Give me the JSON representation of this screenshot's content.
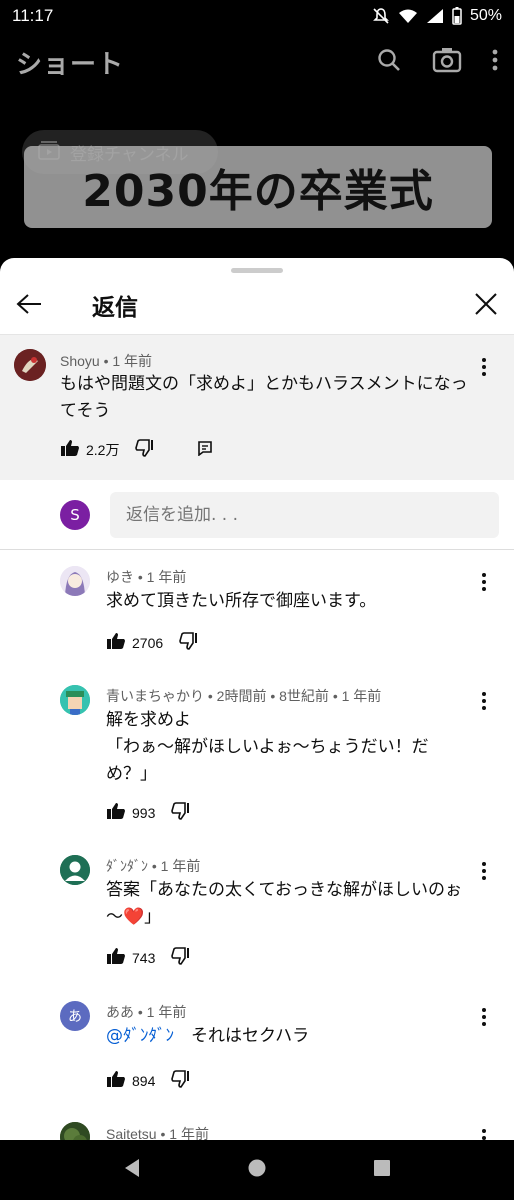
{
  "status": {
    "time": "11:17",
    "battery": "50%"
  },
  "header": {
    "title": "ショート"
  },
  "video": {
    "subscribed_label": "登録チャンネル",
    "caption": "2030年の卒業式"
  },
  "sheet": {
    "title": "返信"
  },
  "parent": {
    "author": "Shoyu • 1 年前",
    "text": "もはや問題文の「求めよ」とかもハラスメントになってそう",
    "likes": "2.2万"
  },
  "composer": {
    "avatar_letter": "S",
    "placeholder": "返信を追加. . ."
  },
  "replies": [
    {
      "author": "ゆき • 1 年前",
      "text": "求めて頂きたい所存で御座います。",
      "likes": "2706"
    },
    {
      "author": "青いまちゃかり • 2時間前 • 8世紀前 • 1 年前",
      "text1": "解を求めよ",
      "text2": "「わぁ～解がほしいよぉ～ちょうだい！だめ？」",
      "likes": "993"
    },
    {
      "author": "ﾀﾞﾝﾀﾞﾝ • 1 年前",
      "text": "答案「あなたの太くておっきな解がほしいのぉ～❤️」",
      "likes": "743"
    },
    {
      "author": "ああ • 1 年前",
      "avatar_letter": "あ",
      "mention": "@ﾀﾞﾝﾀﾞﾝ",
      "text": "それはセクハラ",
      "likes": "894"
    },
    {
      "author": "Saitetsu • 1 年前"
    }
  ]
}
